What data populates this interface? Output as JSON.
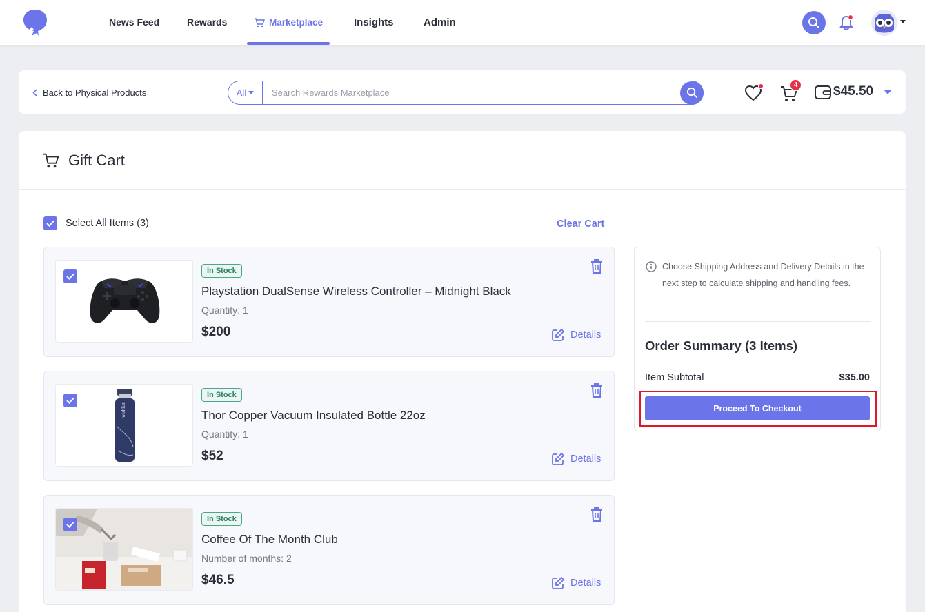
{
  "nav": {
    "items": [
      {
        "label": "News Feed"
      },
      {
        "label": "Rewards"
      },
      {
        "label": "Marketplace",
        "active": true
      },
      {
        "label": "Insights"
      },
      {
        "label": "Admin"
      }
    ],
    "accent_color": "#6b74e8",
    "icons": {
      "logo": "balloon-logo-icon",
      "search": "search-icon",
      "bell": "bell-icon",
      "avatar": "owl-avatar"
    }
  },
  "toolbar": {
    "back_label": "Back to Physical Products",
    "search_scope": "All",
    "search_placeholder": "Search Rewards Marketplace",
    "search_value": "",
    "cart_count": "4",
    "balance": "$45.50"
  },
  "cart": {
    "title": "Gift Cart",
    "select_all_label": "Select All Items (3)",
    "clear_label": "Clear Cart",
    "items": [
      {
        "stock": "In Stock",
        "name": "Playstation DualSense Wireless Controller – Midnight Black",
        "qty": "Quantity: 1",
        "price": "$200",
        "details": "Details",
        "checked": true
      },
      {
        "stock": "In Stock",
        "name": "Thor Copper Vacuum Insulated Bottle 22oz",
        "qty": "Quantity: 1",
        "price": "$52",
        "details": "Details",
        "checked": true
      },
      {
        "stock": "In Stock",
        "name": "Coffee Of The Month Club",
        "qty": "Number of months: 2",
        "price": "$46.5",
        "details": "Details",
        "checked": true
      }
    ]
  },
  "summary": {
    "note": "Choose Shipping Address and Delivery Details in the next step to calculate shipping and handling fees.",
    "title": "Order Summary (3 Items)",
    "subtotal_label": "Item Subtotal",
    "subtotal_value": "$35.00",
    "checkout_label": "Proceed To Checkout"
  }
}
